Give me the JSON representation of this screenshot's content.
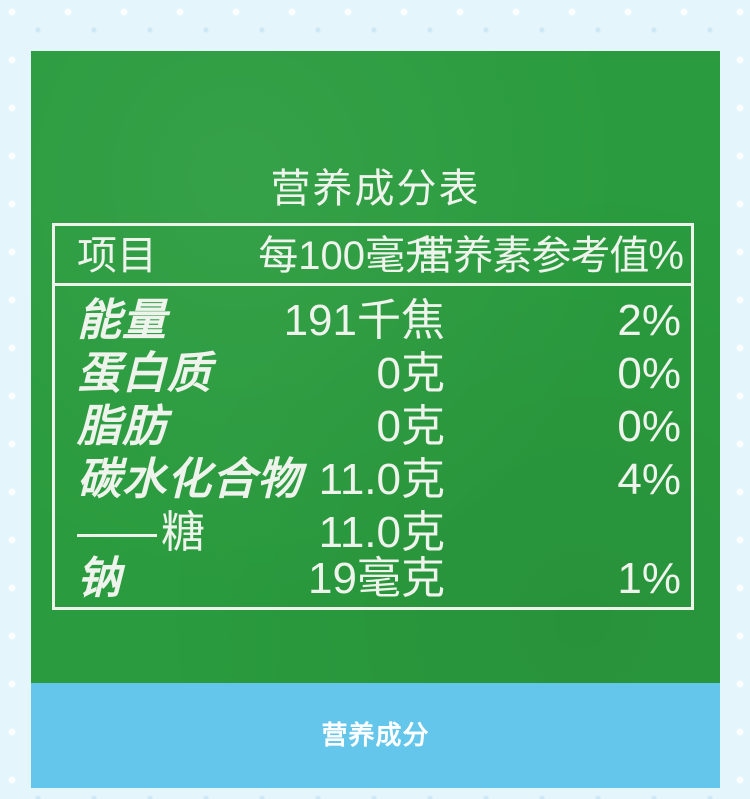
{
  "label": {
    "title": "营养成分表",
    "header": {
      "item": "项目",
      "per100": "每100毫升",
      "nrv": "营养素参考值%"
    },
    "rows": [
      {
        "name": "能量",
        "amount": "191千焦",
        "nrv": "2%"
      },
      {
        "name": "蛋白质",
        "amount": "0克",
        "nrv": "0%"
      },
      {
        "name": "脂肪",
        "amount": "0克",
        "nrv": "0%"
      },
      {
        "name": "碳水化合物",
        "amount": "11.0克",
        "nrv": "4%"
      },
      {
        "name": "糖",
        "amount": "11.0克",
        "nrv": ""
      },
      {
        "name": "钠",
        "amount": "19毫克",
        "nrv": "1%"
      }
    ]
  },
  "caption": {
    "text": "营养成分"
  },
  "colors": {
    "label_green": "#2a9b3e",
    "caption_blue": "#63c6ea",
    "page_background": "#e4f5fc"
  }
}
